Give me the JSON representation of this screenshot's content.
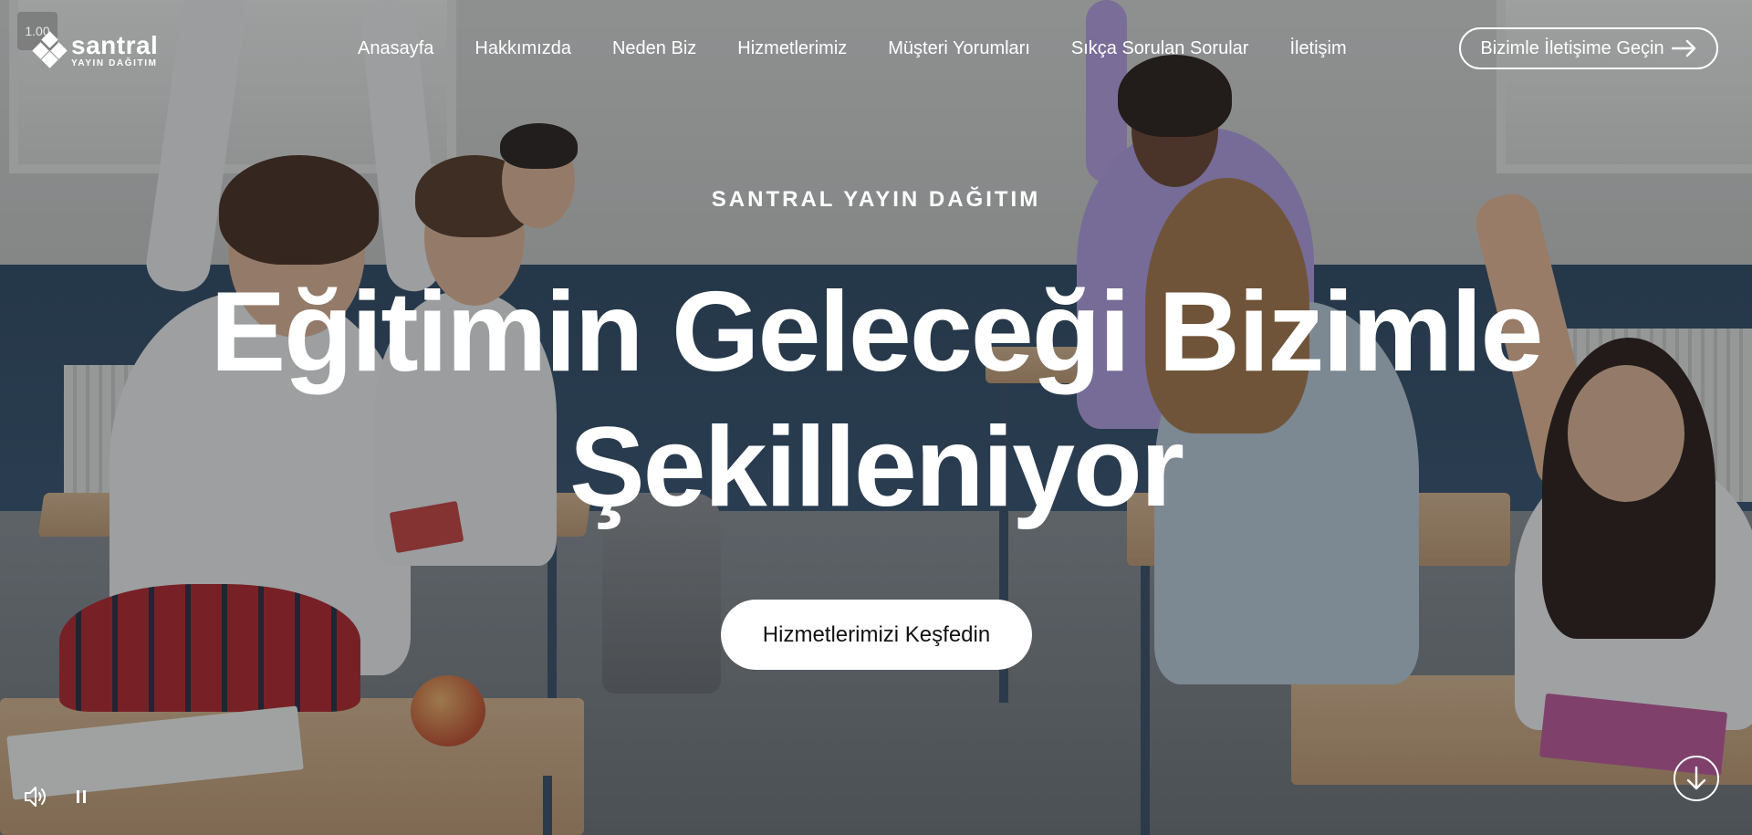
{
  "video": {
    "speed_label": "1.00"
  },
  "brand": {
    "name": "santral",
    "subtitle": "YAYIN DAĞITIM"
  },
  "nav": {
    "items": [
      {
        "label": "Anasayfa"
      },
      {
        "label": "Hakkımızda"
      },
      {
        "label": "Neden Biz"
      },
      {
        "label": "Hizmetlerimiz"
      },
      {
        "label": "Müşteri Yorumları"
      },
      {
        "label": "Sıkça Sorulan Sorular"
      },
      {
        "label": "İletişim"
      }
    ],
    "cta_label": "Bizimle İletişime Geçin",
    "cta_icon": "arrow-right-icon"
  },
  "hero": {
    "eyebrow": "SANTRAL YAYIN DAĞITIM",
    "headline_line1": "Eğitimin Geleceği Bizimle",
    "headline_line2": "Şekilleniyor",
    "cta_label": "Hizmetlerimizi Keşfedin"
  },
  "controls": {
    "volume_icon": "volume-icon",
    "pause_icon": "pause-icon",
    "scroll_icon": "arrow-down-circle-icon"
  },
  "colors": {
    "text": "#ffffff",
    "button_bg": "#ffffff",
    "button_text": "#111111",
    "overlay": "#14191f"
  }
}
